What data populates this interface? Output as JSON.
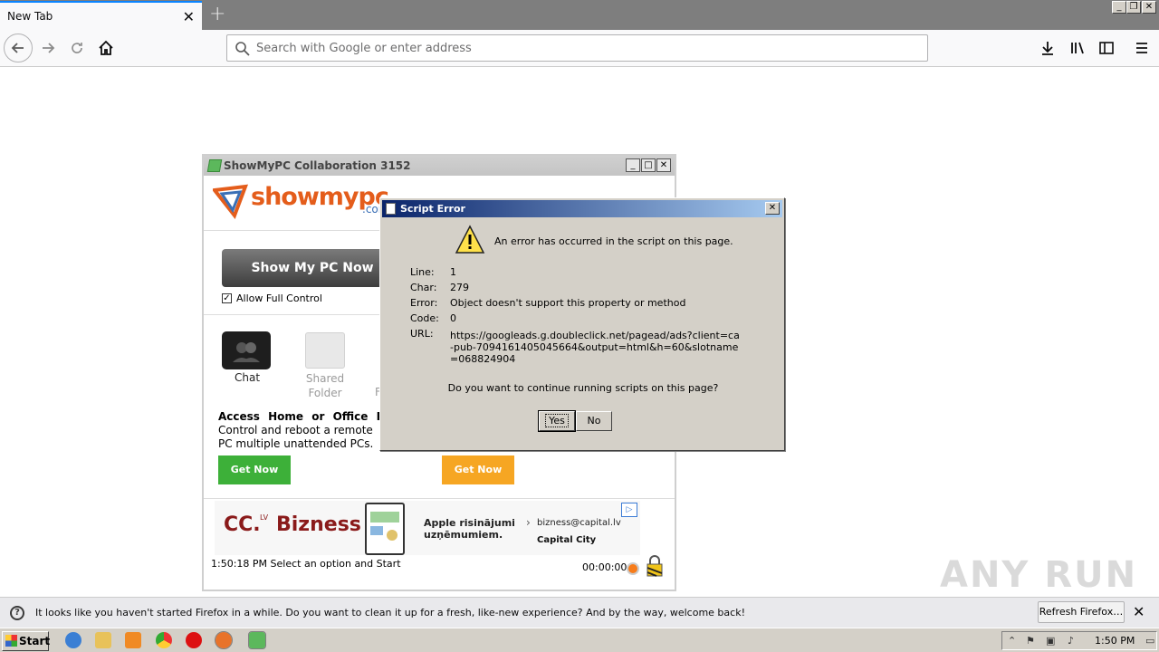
{
  "browser": {
    "tab_title": "New Tab",
    "search_placeholder": "Search with Google or enter address"
  },
  "showmypc": {
    "window_title": "ShowMyPC Collaboration 3152",
    "logo_text": "showmypc",
    "logo_com": ".com",
    "show_btn": "Show My PC Now",
    "allow_label": "Allow Full Control",
    "allow_checked": true,
    "features": [
      {
        "label": "Chat"
      },
      {
        "label": "Shared Folder"
      },
      {
        "label": "F"
      }
    ],
    "access_head": "Access Home or Office PC",
    "access_body": "Control and reboot a remote PC multiple unattended PCs.",
    "get_now_1": "Get Now",
    "get_now_2": "Get Now",
    "ad": {
      "cc": "CC.",
      "lv": "LV",
      "bizness": "Bizness",
      "apple_line1": "Apple risinājumi",
      "apple_line2": "uzņēmumiem.",
      "email": "bizness@capital.lv",
      "capital": "Capital City"
    },
    "status_text": "1:50:18 PM Select an option and Start",
    "timer": "00:00:00"
  },
  "dialog": {
    "title": "Script Error",
    "message": "An error has occurred in the script on this page.",
    "fields": [
      {
        "key": "Line:",
        "value": "1"
      },
      {
        "key": "Char:",
        "value": "279"
      },
      {
        "key": "Error:",
        "value": "Object doesn't support this property or method"
      },
      {
        "key": "Code:",
        "value": "0"
      },
      {
        "key": "URL:",
        "value": "https://googleads.g.doubleclick.net/pagead/ads?client=ca-pub-7094161405045664&output=html&h=60&slotname=068824904"
      }
    ],
    "question": "Do you want to continue running scripts on this page?",
    "yes": "Yes",
    "no": "No"
  },
  "notification": {
    "text": "It looks like you haven't started Firefox in a while. Do you want to clean it up for a fresh, like-new experience? And by the way, welcome back!",
    "button": "Refresh Firefox…"
  },
  "watermark": "ANY RUN",
  "taskbar": {
    "start": "Start",
    "time": "1:50 PM"
  }
}
